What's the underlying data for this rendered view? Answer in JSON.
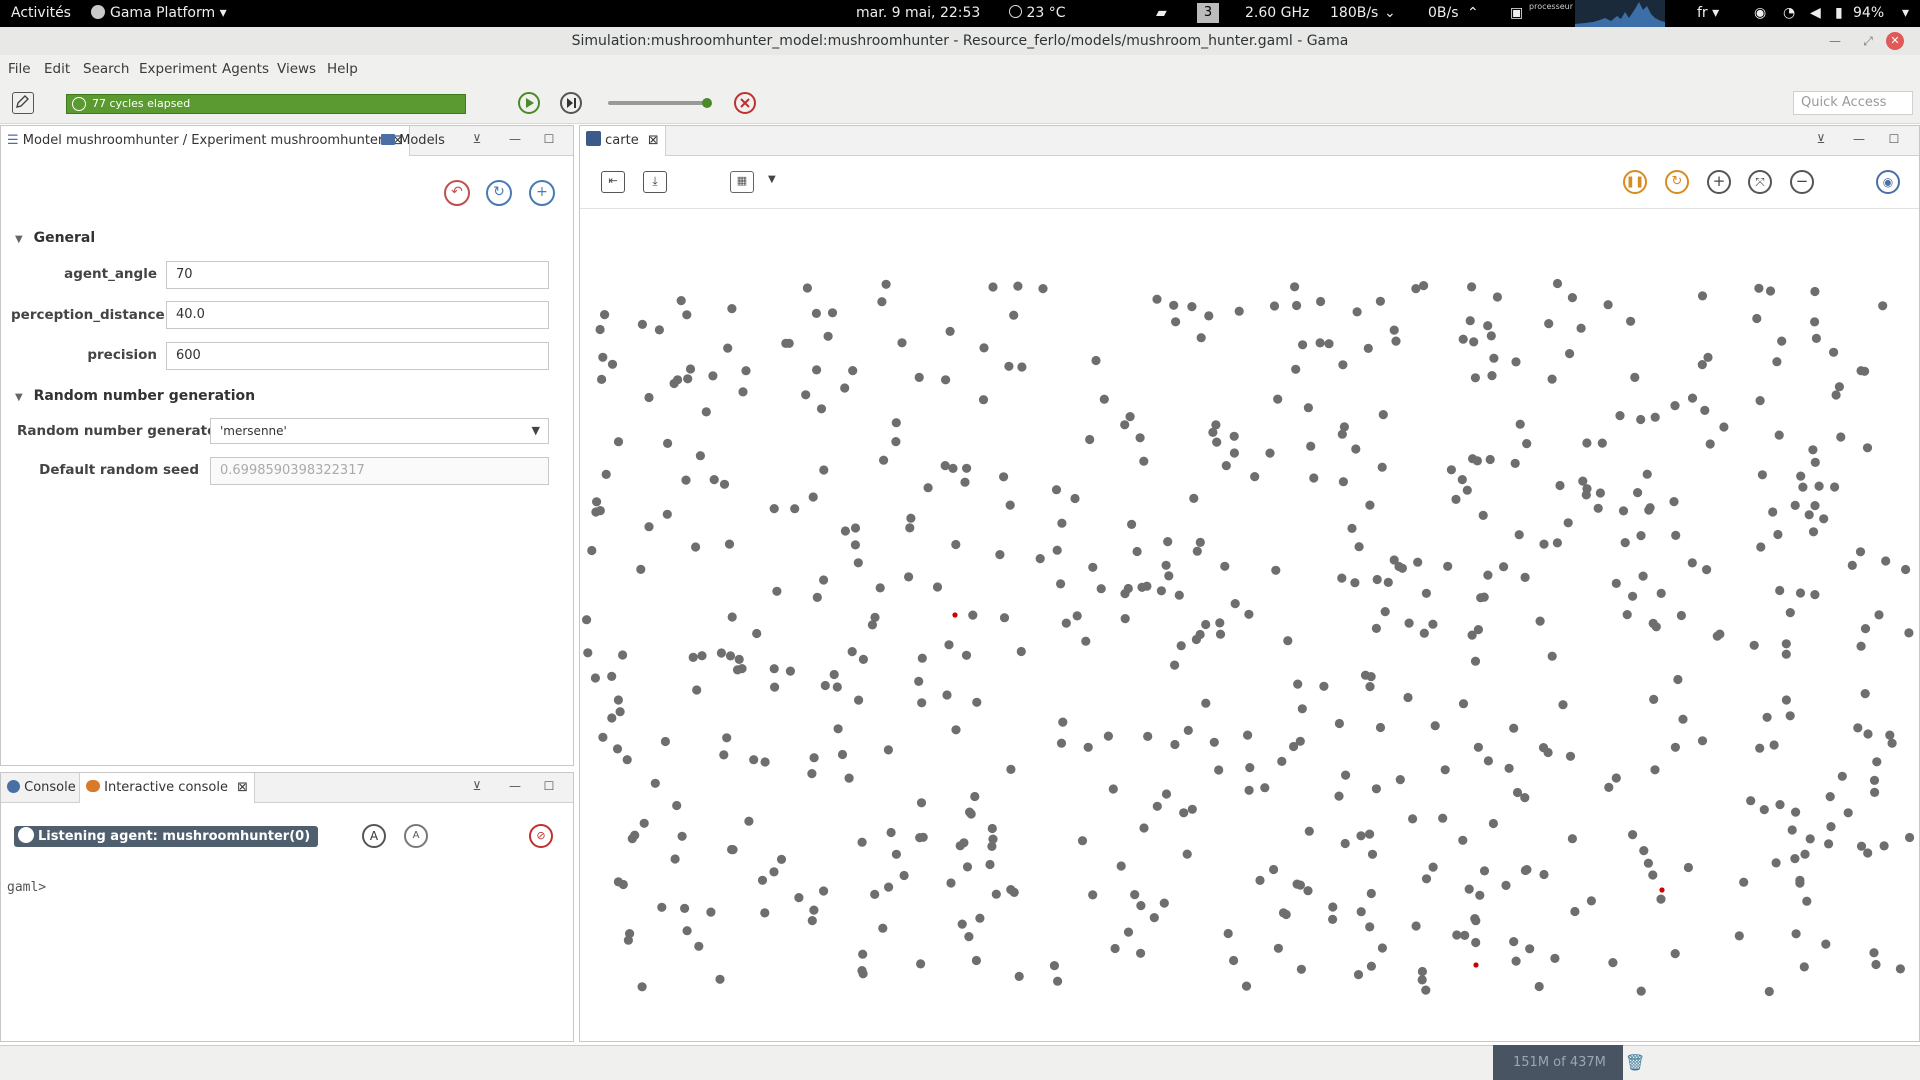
{
  "topbar": {
    "activities": "Activités",
    "app_menu": "Gama Platform",
    "datetime": "mar.  9 mai, 22:53",
    "temperature": "23 °C",
    "workspace": "3",
    "cpu_freq": "2.60 GHz",
    "net_down": "180B/s",
    "net_up": "0B/s",
    "processor_label": "processeur",
    "language": "fr",
    "battery": "94%"
  },
  "window": {
    "title": "Simulation:mushroomhunter_model:mushroomhunter - Resource_ferlo/models/mushroom_hunter.gaml - Gama"
  },
  "menu": {
    "items": [
      "File",
      "Edit",
      "Search",
      "Experiment",
      "Agents",
      "Views",
      "Help"
    ]
  },
  "toolbar": {
    "progress_text": "77 cycles elapsed",
    "speed_fraction": 1.0,
    "quick_access_placeholder": "Quick Access"
  },
  "params_panel": {
    "tab_label": "Model mushroomhunter / Experiment mushroomhunter",
    "models_tab_label": "Models",
    "section_general": "General",
    "params": [
      {
        "label": "agent_angle",
        "value": "70"
      },
      {
        "label": "perception_distance",
        "value": "40.0"
      },
      {
        "label": "precision",
        "value": "600"
      }
    ],
    "section_random": "Random number generation",
    "rng_label": "Random number generator",
    "rng_value": "'mersenne'",
    "seed_label": "Default random seed",
    "seed_value": "0.6998590398322317"
  },
  "console_panel": {
    "console_tab": "Console",
    "interactive_tab": "Interactive console",
    "listening": "Listening agent: mushroomhunter(0)",
    "prompt": "gaml>"
  },
  "display_panel": {
    "tab_label": "carte",
    "dot_color": "#6e6e6e",
    "hunter_color": "#d00000"
  },
  "status": {
    "memory": "151M of 437M"
  },
  "colors": {
    "progress": "#5a9a30",
    "accent_green": "#4a8a2a"
  }
}
